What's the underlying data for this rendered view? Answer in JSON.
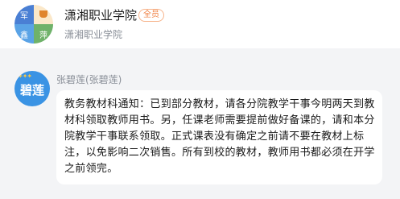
{
  "group": {
    "name": "潇湘职业学院",
    "badge": "全员",
    "subtitle": "潇湘职业学院",
    "avatar_chars": [
      "军",
      "鑫",
      "萍"
    ]
  },
  "message": {
    "sender": "张碧莲(张碧莲)",
    "avatar_text": "碧莲",
    "avatar_color": "#3a93e4",
    "text": "教务教材科通知：已到部分教材，请各分院教学干事今明两天到教材科领取教师用书。另，任课老师需要提前做好备课的，请和本分院教学干事联系领取。正式课表没有确定之前请不要在教材上标注，以免影响二次销售。所有到校的教材，教师用书都必须在开学之前领完。"
  }
}
